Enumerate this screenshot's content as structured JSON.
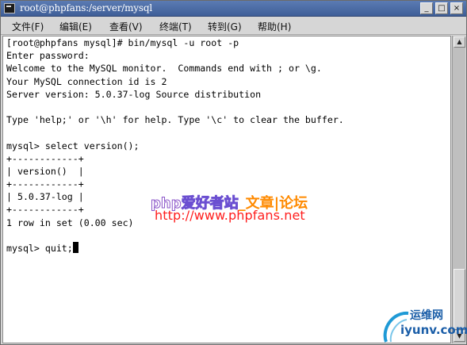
{
  "window": {
    "title": "root@phpfans:/server/mysql",
    "controls": {
      "minimize": "_",
      "maximize": "□",
      "close": "×"
    }
  },
  "menu": [
    "文件(F)",
    "编辑(E)",
    "查看(V)",
    "终端(T)",
    "转到(G)",
    "帮助(H)"
  ],
  "terminal": {
    "lines": [
      "[root@phpfans mysql]# bin/mysql -u root -p",
      "Enter password:",
      "Welcome to the MySQL monitor.  Commands end with ; or \\g.",
      "Your MySQL connection id is 2",
      "Server version: 5.0.37-log Source distribution",
      "",
      "Type 'help;' or '\\h' for help. Type '\\c' to clear the buffer.",
      "",
      "mysql> select version();",
      "+------------+",
      "| version()  |",
      "+------------+",
      "| 5.0.37-log |",
      "+------------+",
      "1 row in set (0.00 sec)",
      "",
      "mysql> quit;"
    ]
  },
  "watermark": {
    "title_parts": [
      "php",
      "爱好者站",
      "_文章",
      "|论坛"
    ],
    "url": "http://www.phpfans.net"
  },
  "logo": {
    "cn": "运维网",
    "en": "iyunv.com"
  },
  "colors": {
    "titlebar": "#4a6aa5",
    "terminal_bg": "#ffffff",
    "watermark_url": "#ff1e1e",
    "logo": "#1b5ea8"
  }
}
